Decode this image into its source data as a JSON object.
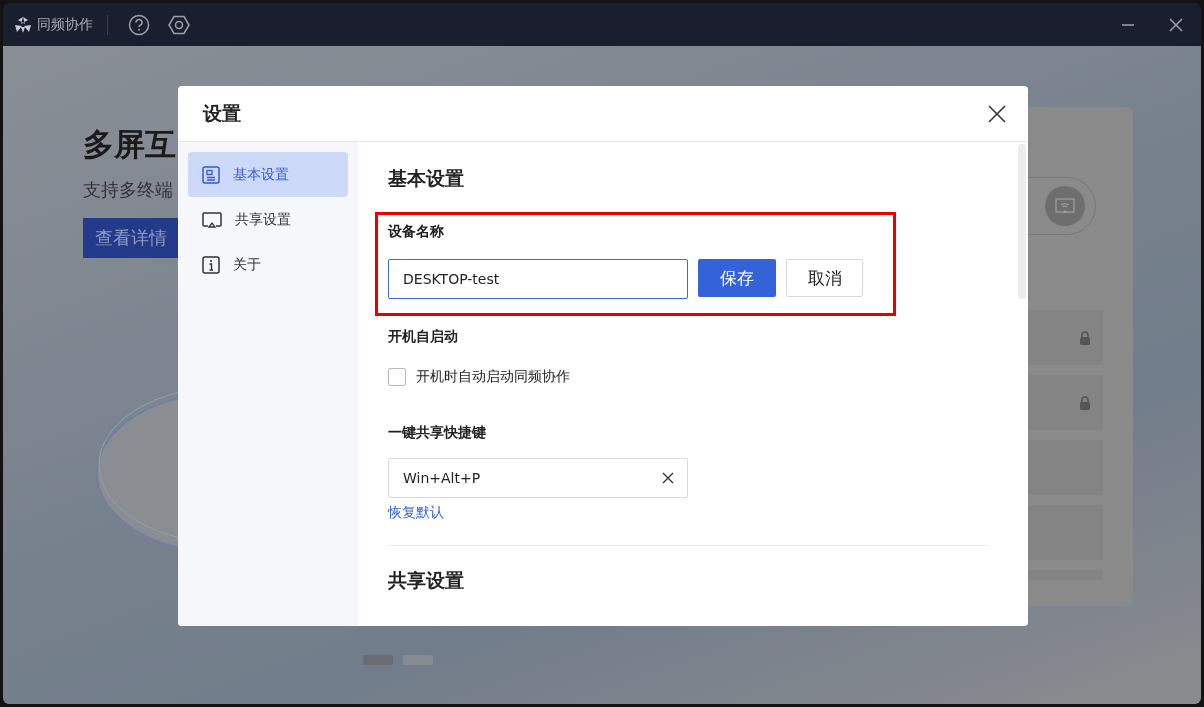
{
  "app": {
    "title": "同频协作"
  },
  "hero": {
    "title": "多屏互",
    "subtitle": "支持多终端",
    "button": "查看详情"
  },
  "background_card": {
    "rows": [
      {
        "locked": true
      },
      {
        "locked": true
      },
      {
        "locked": false
      },
      {
        "locked": false
      }
    ]
  },
  "carousel": [
    {
      "selected": true
    },
    {
      "selected": false
    }
  ],
  "dialog": {
    "title": "设置",
    "nav": [
      {
        "label": "基本设置",
        "kind": "document",
        "selected": true
      },
      {
        "label": "共享设置",
        "kind": "screen",
        "selected": false
      },
      {
        "label": "关于",
        "kind": "info",
        "selected": false
      }
    ],
    "section_title": "基本设置",
    "device_name": {
      "label": "设备名称",
      "value": "DESKTOP-test",
      "save": "保存",
      "cancel": "取消",
      "highlighted": true
    },
    "autostart": {
      "label": "开机自启动",
      "option": "开机时自动启动同频协作",
      "checked": false
    },
    "shortcut": {
      "label": "一键共享快捷键",
      "value": "Win+Alt+P",
      "reset": "恢复默认"
    },
    "next_section_title": "共享设置"
  }
}
